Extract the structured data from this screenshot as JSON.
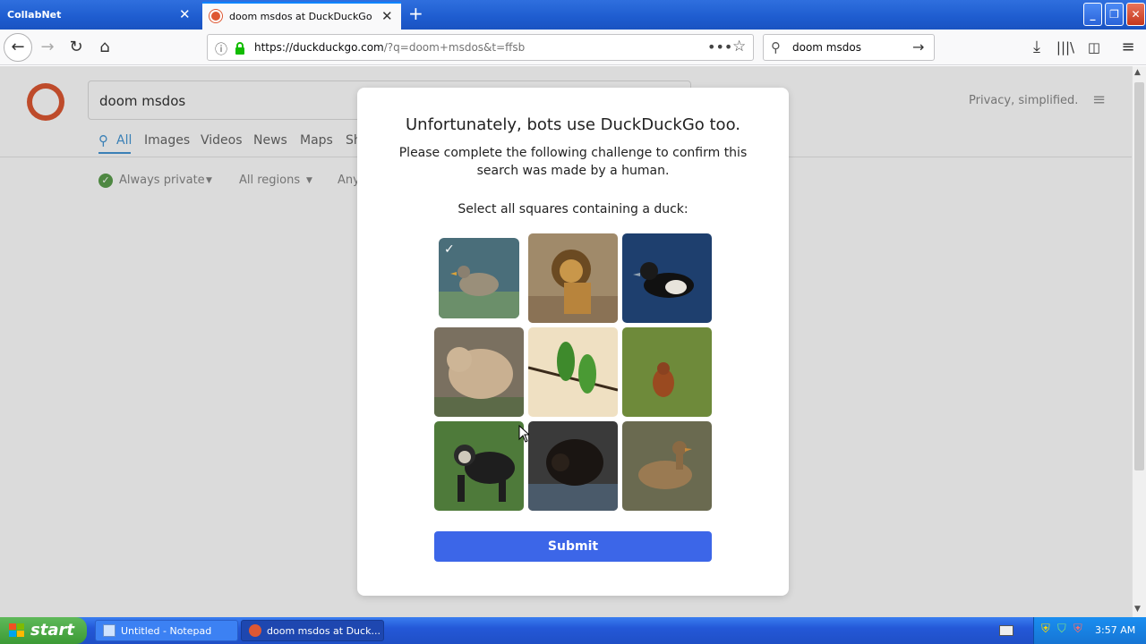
{
  "tabs": [
    {
      "label": "CollabNet"
    },
    {
      "label": "doom msdos at DuckDuckGo"
    }
  ],
  "toolbar": {
    "url_host": "https://duckduckgo.com",
    "url_path": "/?q=doom+msdos&t=ffsb",
    "search_value": "doom msdos"
  },
  "ddg": {
    "search_value": "doom msdos",
    "tabs": [
      "All",
      "Images",
      "Videos",
      "News",
      "Maps",
      "Sh"
    ],
    "privacy_text": "Privacy, simplified.",
    "filters": [
      "Always private",
      "All regions",
      "Any"
    ]
  },
  "captcha": {
    "title": "Unfortunately, bots use DuckDuckGo too.",
    "description": "Please complete the following challenge to confirm this search was made by a human.",
    "instruction": "Select all squares containing a duck:",
    "submit_label": "Submit",
    "tiles": [
      {
        "subject": "duck",
        "selected": true
      },
      {
        "subject": "lion",
        "selected": false
      },
      {
        "subject": "duck",
        "selected": false
      },
      {
        "subject": "bear",
        "selected": false
      },
      {
        "subject": "parrots",
        "selected": false
      },
      {
        "subject": "orangutan",
        "selected": false
      },
      {
        "subject": "monkey",
        "selected": false
      },
      {
        "subject": "bear",
        "selected": false
      },
      {
        "subject": "duck",
        "selected": false
      }
    ]
  },
  "taskbar": {
    "start_label": "start",
    "items": [
      "Untitled - Notepad",
      "doom msdos at Duck..."
    ],
    "time": "3:57 AM"
  },
  "colors": {
    "accent": "#3c66e8",
    "ddg_orange": "#de5833",
    "tab_active_line": "#0a84ff"
  }
}
